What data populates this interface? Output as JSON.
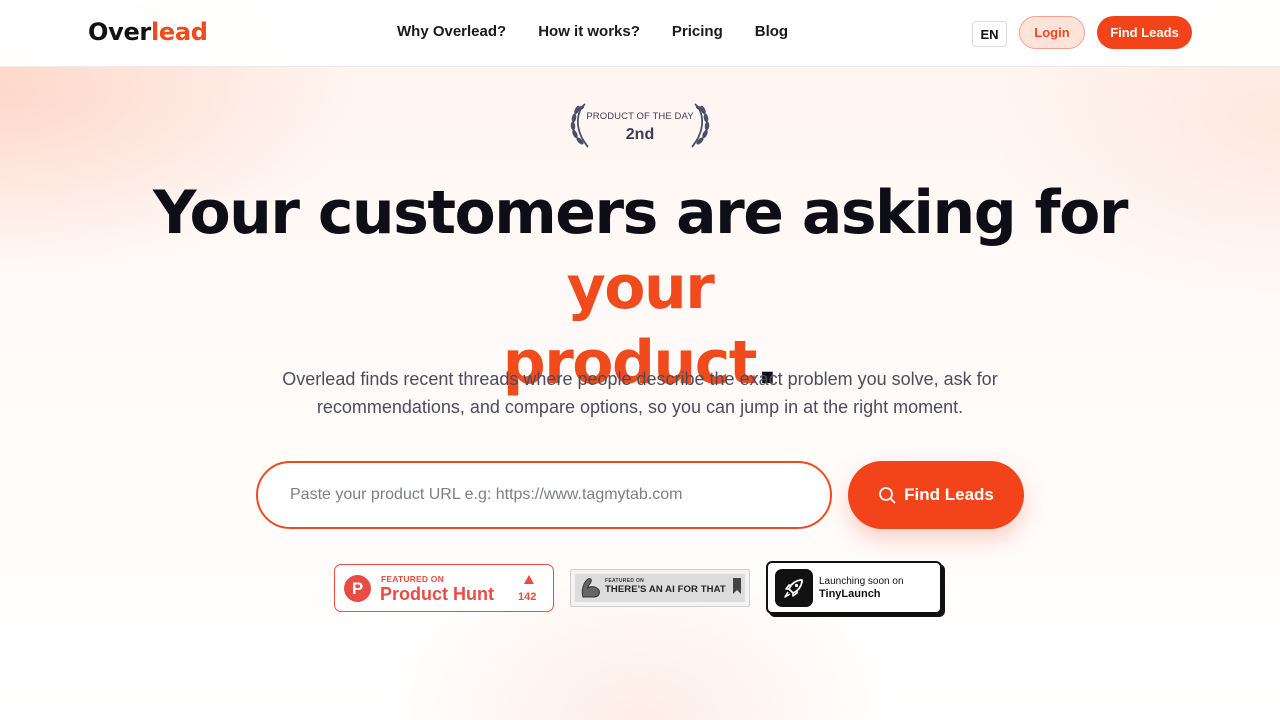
{
  "header": {
    "logo_part1": "Over",
    "logo_part2": "lead",
    "nav": [
      "Why Overlead?",
      "How it works?",
      "Pricing",
      "Blog"
    ],
    "lang": "EN",
    "login_label": "Login",
    "find_label": "Find Leads"
  },
  "award": {
    "label": "PRODUCT OF THE DAY",
    "rank": "2nd"
  },
  "hero": {
    "line1_plain": "Your customers are asking for ",
    "line1_highlight": "your",
    "line2_highlight": "product",
    "line2_end": "."
  },
  "description": "Overlead finds recent threads where people describe the exact problem you solve, ask for recommendations, and compare options, so you can jump in at the right moment.",
  "search": {
    "placeholder": "Paste your product URL e.g: https://www.tagmytab.com",
    "value": "",
    "button_label": "Find Leads"
  },
  "badges": {
    "producthunt": {
      "eyebrow": "FEATURED ON",
      "name": "Product Hunt",
      "count": "142"
    },
    "aiforthat": {
      "eyebrow": "FEATURED ON",
      "name": "THERE'S AN AI FOR THAT"
    },
    "tinylaunch": {
      "eyebrow": "Launching soon on",
      "name": "TinyLaunch"
    }
  },
  "colors": {
    "accent": "#f2431a",
    "text_dark": "#0e0e16",
    "text_muted": "#4a4d5a",
    "producthunt": "#e94c45"
  },
  "icons": [
    "laurel-left-icon",
    "laurel-right-icon",
    "search-icon",
    "producthunt-logo-icon",
    "upvote-triangle-icon",
    "bicep-icon",
    "bookmark-icon",
    "rocket-icon"
  ]
}
